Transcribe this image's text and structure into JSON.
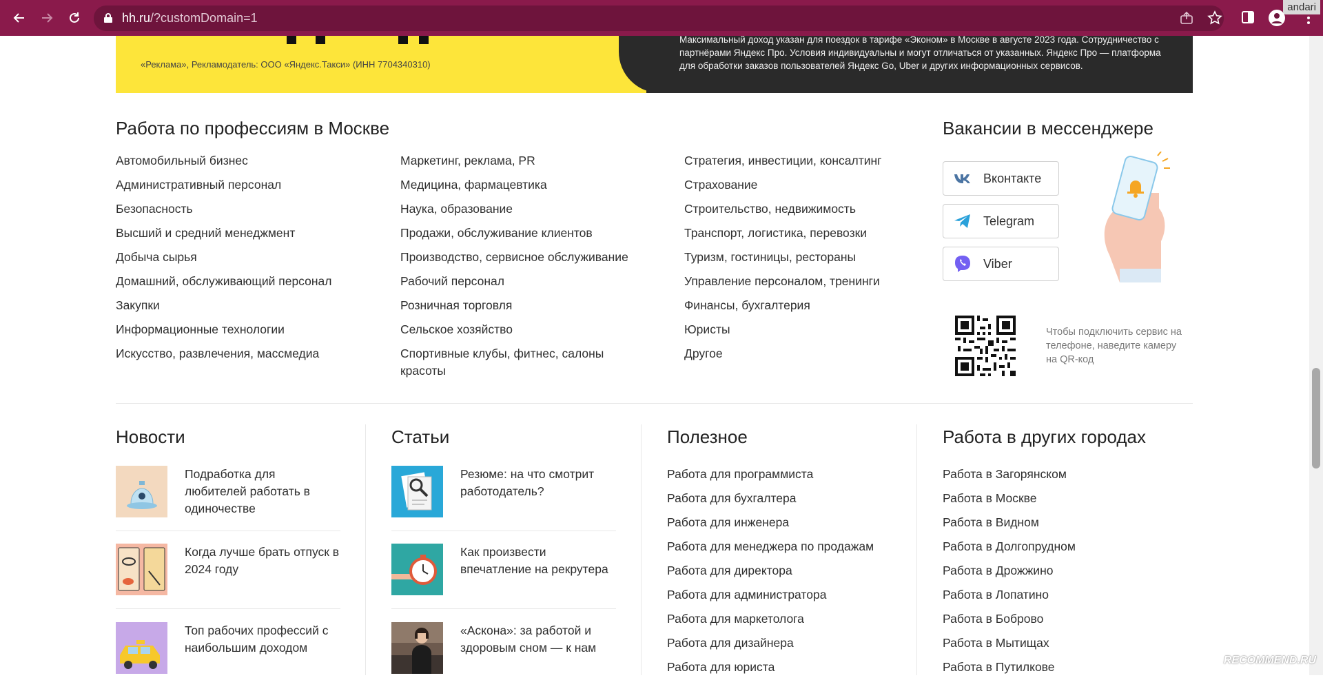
{
  "browser": {
    "url_host": "hh.ru",
    "url_path": "/?customDomain=1",
    "profile_name": "andari"
  },
  "banner": {
    "ad_disclaimer": "«Реклама», Рекламодатель: ООО «Яндекс.Такси» (ИНН 7704340310)",
    "ad_text": "Максимальный доход указан для поездок в тарифе «Эконом» в Москве в августе 2023 года. Сотрудничество с партнёрами Яндекс Про. Условия индивидуальны и могут отличаться от указанных. Яндекс Про — платформа для обработки заказов пользователей Яндекс Go, Uber и других информационных сервисов."
  },
  "professions": {
    "title": "Работа по профессиям в Москве",
    "col1": [
      "Автомобильный бизнес",
      "Административный персонал",
      "Безопасность",
      "Высший и средний менеджмент",
      "Добыча сырья",
      "Домашний, обслуживающий персонал",
      "Закупки",
      "Информационные технологии",
      "Искусство, развлечения, массмедиа"
    ],
    "col2": [
      "Маркетинг, реклама, PR",
      "Медицина, фармацевтика",
      "Наука, образование",
      "Продажи, обслуживание клиентов",
      "Производство, сервисное обслуживание",
      "Рабочий персонал",
      "Розничная торговля",
      "Сельское хозяйство",
      "Спортивные клубы, фитнес, салоны красоты"
    ],
    "col3": [
      "Стратегия, инвестиции, консалтинг",
      "Страхование",
      "Строительство, недвижимость",
      "Транспорт, логистика, перевозки",
      "Туризм, гостиницы, рестораны",
      "Управление персоналом, тренинги",
      "Финансы, бухгалтерия",
      "Юристы",
      "Другое"
    ]
  },
  "messenger": {
    "title": "Вакансии в мессенджере",
    "buttons": [
      "Вконтакте",
      "Telegram",
      "Viber"
    ],
    "qr_note": "Чтобы подключить сервис на телефоне, наведите камеру на QR-код",
    "colors": {
      "vk": "#4c75a3",
      "telegram": "#2aa1da",
      "viber": "#7360f2"
    }
  },
  "news": {
    "title": "Новости",
    "items": [
      "Подработка для любителей работать в одиночестве",
      "Когда лучше брать отпуск в 2024 году",
      "Топ рабочих профессий с наибольшим доходом"
    ]
  },
  "articles": {
    "title": "Статьи",
    "items": [
      "Резюме: на что смотрит работодатель?",
      "Как произвести впечатление на рекрутера",
      "«Аскона»: за работой и здоровым сном — к нам"
    ]
  },
  "useful": {
    "title": "Полезное",
    "items": [
      "Работа для программиста",
      "Работа для бухгалтера",
      "Работа для инженера",
      "Работа для менеджера по продажам",
      "Работа для директора",
      "Работа для администратора",
      "Работа для маркетолога",
      "Работа для дизайнера",
      "Работа для юриста"
    ]
  },
  "cities": {
    "title": "Работа в других городах",
    "items": [
      "Работа в Загорянском",
      "Работа в Москве",
      "Работа в Видном",
      "Работа в Долгопрудном",
      "Работа в Дрожжино",
      "Работа в Лопатино",
      "Работа в Боброво",
      "Работа в Мытищах",
      "Работа в Путилкове"
    ]
  },
  "watermark": "RECOMMEND.RU"
}
